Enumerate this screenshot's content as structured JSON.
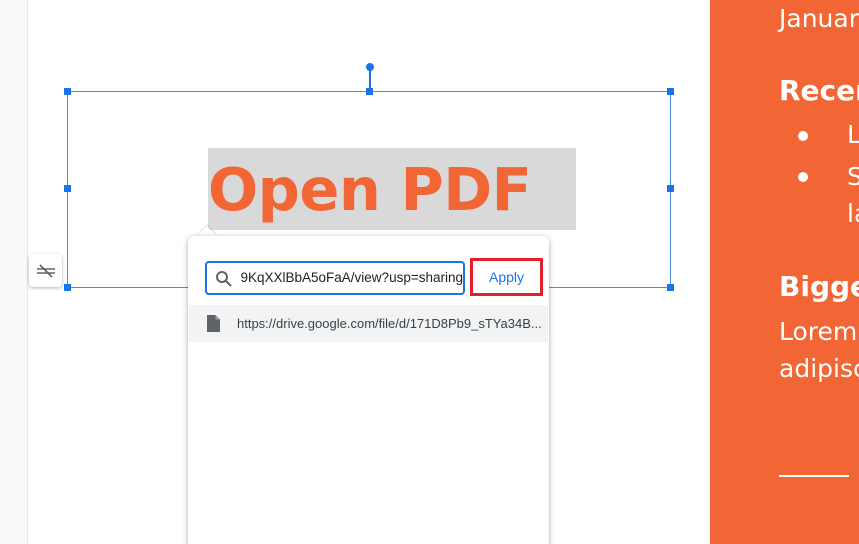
{
  "canvas": {
    "heading": "Open PDF"
  },
  "link_popup": {
    "url_value": "https://drive.google.com/file/d/171D8Pb9_sTYa34B9KqXXlBbA5oFaA/view?usp=sharing",
    "apply_label": "Apply",
    "suggestion_text": "https://drive.google.com/file/d/171D8Pb9_sTYa34B..."
  },
  "right_panel": {
    "date_fragment": "Januar",
    "recent_heading_fragment": "Recer",
    "bullet_1_fragment": "L",
    "bullet_2_fragment": "S",
    "bullet_2_cont_fragment": "la",
    "bigger_heading_fragment": "Bigge",
    "body_line_1_fragment": "Lorem",
    "body_line_2_fragment": "adipisc"
  },
  "colors": {
    "accent_orange": "#f26535",
    "selection_blue": "#1a73e8",
    "highlight_red": "#e0202a"
  },
  "icons": [
    "search-icon",
    "file-icon",
    "unlink-icon"
  ]
}
